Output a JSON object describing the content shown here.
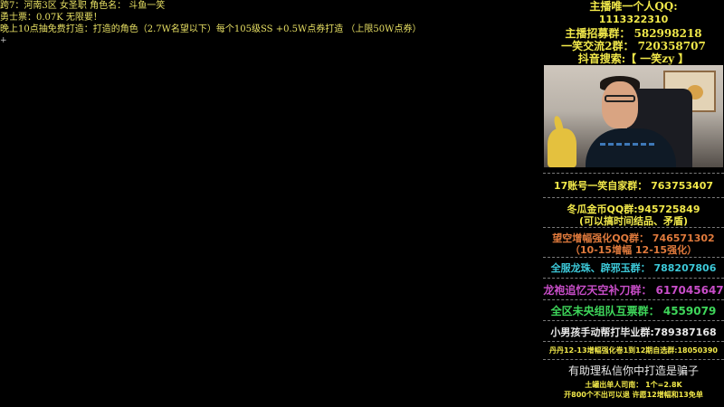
{
  "overlay": {
    "lines": [
      "跨7：河南3区  女圣职  角色名：  斗鱼一笑",
      "勇士票：0.07K 无限要！",
      "晚上10点抽免费打造：打造的角色（2.7W名望以下）每个105级SS +0.5W点券打造 （上限50W点券）"
    ],
    "cursor_mark": "+"
  },
  "sidebar": {
    "qq_label": "主播唯一个人QQ:",
    "qq_number": "1113322310",
    "recruit": "主播招募群：  582998218",
    "exchange2": "一笑交流2群：  720358707",
    "douyin": "抖音搜索:【 一笑zy 】",
    "groups": [
      {
        "text": "17账号一笑自家群：  763753407",
        "color": "#f2e94a"
      },
      {
        "text": "冬瓜金币QQ群:945725849",
        "color": "#f2e94a"
      },
      {
        "text": "(可以搞时间结品、矛盾)",
        "color": "#f2e94a"
      },
      {
        "text": "望空增幅强化QQ群：  746571302",
        "color": "#e07a3c"
      },
      {
        "text": "（10-15增幅 12-15强化）",
        "color": "#e07a3c"
      },
      {
        "text": "全服龙珠、辟邪玉群：  788207806",
        "color": "#3cc8d8"
      },
      {
        "text": "龙袍追忆天空补刀群：  617045647",
        "color": "#c84dc8"
      },
      {
        "text": "全区未央组队互票群：   4559079",
        "color": "#3ed65a"
      },
      {
        "text": "小男孩手动帮打毕业群:789387168",
        "color": "#e8e8e8"
      },
      {
        "text": "丹丹12-13增幅强化卷1到12期自选群:18050390",
        "color": "#f2e94a"
      },
      {
        "text": "有助理私信你中打造是骗子",
        "color": "#e8e8e8"
      },
      {
        "text": "土罐出单人司南：  1个=2.8K",
        "color": "#f2e94a"
      },
      {
        "text": "开800个不出可以退 许愿12增幅和13免单",
        "color": "#f2e94a"
      }
    ]
  },
  "webcam": {
    "description": "streamer-webcam"
  }
}
